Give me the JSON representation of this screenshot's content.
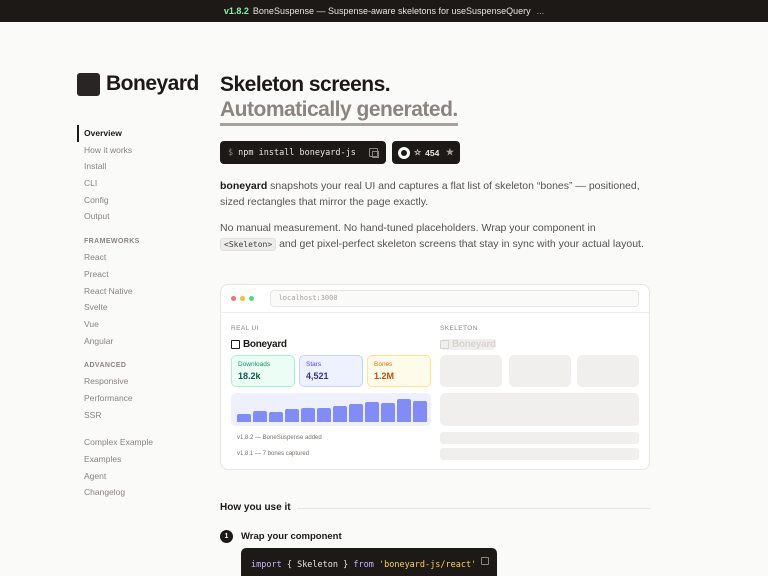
{
  "banner": {
    "version": "v1.8.2",
    "text": "BoneSuspense — Suspense-aware skeletons for useSuspenseQuery",
    "trail": "..."
  },
  "logo": {
    "text": "Boneyard"
  },
  "nav": {
    "items_top": [
      "Overview",
      "How it works",
      "Install",
      "CLI",
      "Config",
      "Output"
    ],
    "frameworks_heading": "FRAMEWORKS",
    "frameworks": [
      "React",
      "Preact",
      "React Native",
      "Svelte",
      "Vue",
      "Angular"
    ],
    "advanced_heading": "ADVANCED",
    "advanced": [
      "Responsive",
      "Performance",
      "SSR"
    ],
    "bottom": [
      "Complex Example",
      "Examples",
      "Agent",
      "Changelog"
    ]
  },
  "hero": {
    "title": "Skeleton screens.",
    "subtitle": "Automatically generated."
  },
  "install": {
    "prompt": "$",
    "command": "npm install boneyard-js"
  },
  "github": {
    "stars": "454",
    "stars_prefix": "☆"
  },
  "intro": {
    "brand": "boneyard",
    "p1_rest": " snapshots your real UI and captures a flat list of skeleton “bones” — positioned, sized rectangles that mirror the page exactly.",
    "p2_before": "No manual measurement. No hand-tuned placeholders. Wrap your component in ",
    "p2_code": "<Skeleton>",
    "p2_after": " and get pixel-perfect skeleton screens that stay in sync with your actual layout."
  },
  "demo": {
    "url": "localhost:3000",
    "real_label": "REAL UI",
    "skeleton_label": "SKELETON",
    "brand": "Boneyard",
    "stats": [
      {
        "label": "Downloads",
        "value": "18.2k",
        "bg": "#ecfdf5",
        "border": "#a7f3d0",
        "label_color": "#059669",
        "value_color": "#065f46"
      },
      {
        "label": "Stars",
        "value": "4,521",
        "bg": "#eef2ff",
        "border": "#c7d2fe",
        "label_color": "#4f46e5",
        "value_color": "#3730a3"
      },
      {
        "label": "Bones",
        "value": "1.2M",
        "bg": "#fffbeb",
        "border": "#fde68a",
        "label_color": "#d97706",
        "value_color": "#b45309"
      }
    ],
    "bars": [
      0.3,
      0.42,
      0.4,
      0.5,
      0.58,
      0.55,
      0.62,
      0.72,
      0.78,
      0.75,
      0.9,
      0.82
    ],
    "log": [
      "v1.8.2 — BoneSuspense added",
      "v1.8.1 — 7 bones captured"
    ]
  },
  "how": {
    "heading": "How you use it",
    "step_number": "1",
    "step_text": "Wrap your component"
  },
  "code": {
    "kw1": "import",
    "mid": " { Skeleton } ",
    "kw2": "from",
    "str": " 'boneyard-js/react'"
  },
  "colors": {
    "accent_bars": "#818cf8",
    "dark": "#1c1917"
  }
}
